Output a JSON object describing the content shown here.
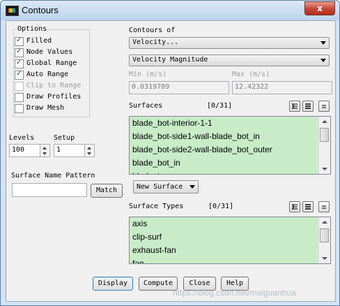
{
  "window": {
    "title": "Contours",
    "close_glyph": "x"
  },
  "options": {
    "legend": "Options",
    "items": [
      {
        "label": "Filled",
        "checked": true,
        "enabled": true
      },
      {
        "label": "Node Values",
        "checked": true,
        "enabled": true
      },
      {
        "label": "Global Range",
        "checked": true,
        "enabled": true
      },
      {
        "label": "Auto Range",
        "checked": true,
        "enabled": true
      },
      {
        "label": "Clip to Range",
        "checked": false,
        "enabled": false
      },
      {
        "label": "Draw Profiles",
        "checked": false,
        "enabled": true
      },
      {
        "label": "Draw Mesh",
        "checked": false,
        "enabled": true
      }
    ]
  },
  "levels": {
    "label": "Levels",
    "value": "100"
  },
  "setup": {
    "label": "Setup",
    "value": "1"
  },
  "surface_name_pattern": {
    "label": "Surface Name Pattern",
    "value": "",
    "match_label": "Match"
  },
  "contours_of": {
    "label": "Contours of",
    "category": "Velocity...",
    "quantity": "Velocity Magnitude"
  },
  "range": {
    "min_label": "Min (m/s)",
    "min_value": "0.0319789",
    "max_label": "Max (m/s)",
    "max_value": "12.42322"
  },
  "surfaces": {
    "label": "Surfaces",
    "count": "[0/31]",
    "items": [
      "blade_bot-interior-1-1",
      "blade_bot-side1-wall-blade_bot_in",
      "blade_bot-side2-wall-blade_bot_outer",
      "blade_bot_in",
      "blade_top"
    ],
    "new_surface_label": "New Surface"
  },
  "surface_types": {
    "label": "Surface Types",
    "count": "[0/31]",
    "items": [
      "axis",
      "clip-surf",
      "exhaust-fan",
      "fan"
    ]
  },
  "buttons": {
    "display": "Display",
    "compute": "Compute",
    "close": "Close",
    "help": "Help"
  },
  "watermark": "https://blog.csdn.net/maiguanhua",
  "colors": {
    "list_bg": "#c8ecc8",
    "title_bar": "#bcd3ee",
    "close_red": "#c44634"
  },
  "icons": [
    "app-icon",
    "select-all-icon",
    "deselect-all-icon",
    "toggle-list-icon"
  ]
}
